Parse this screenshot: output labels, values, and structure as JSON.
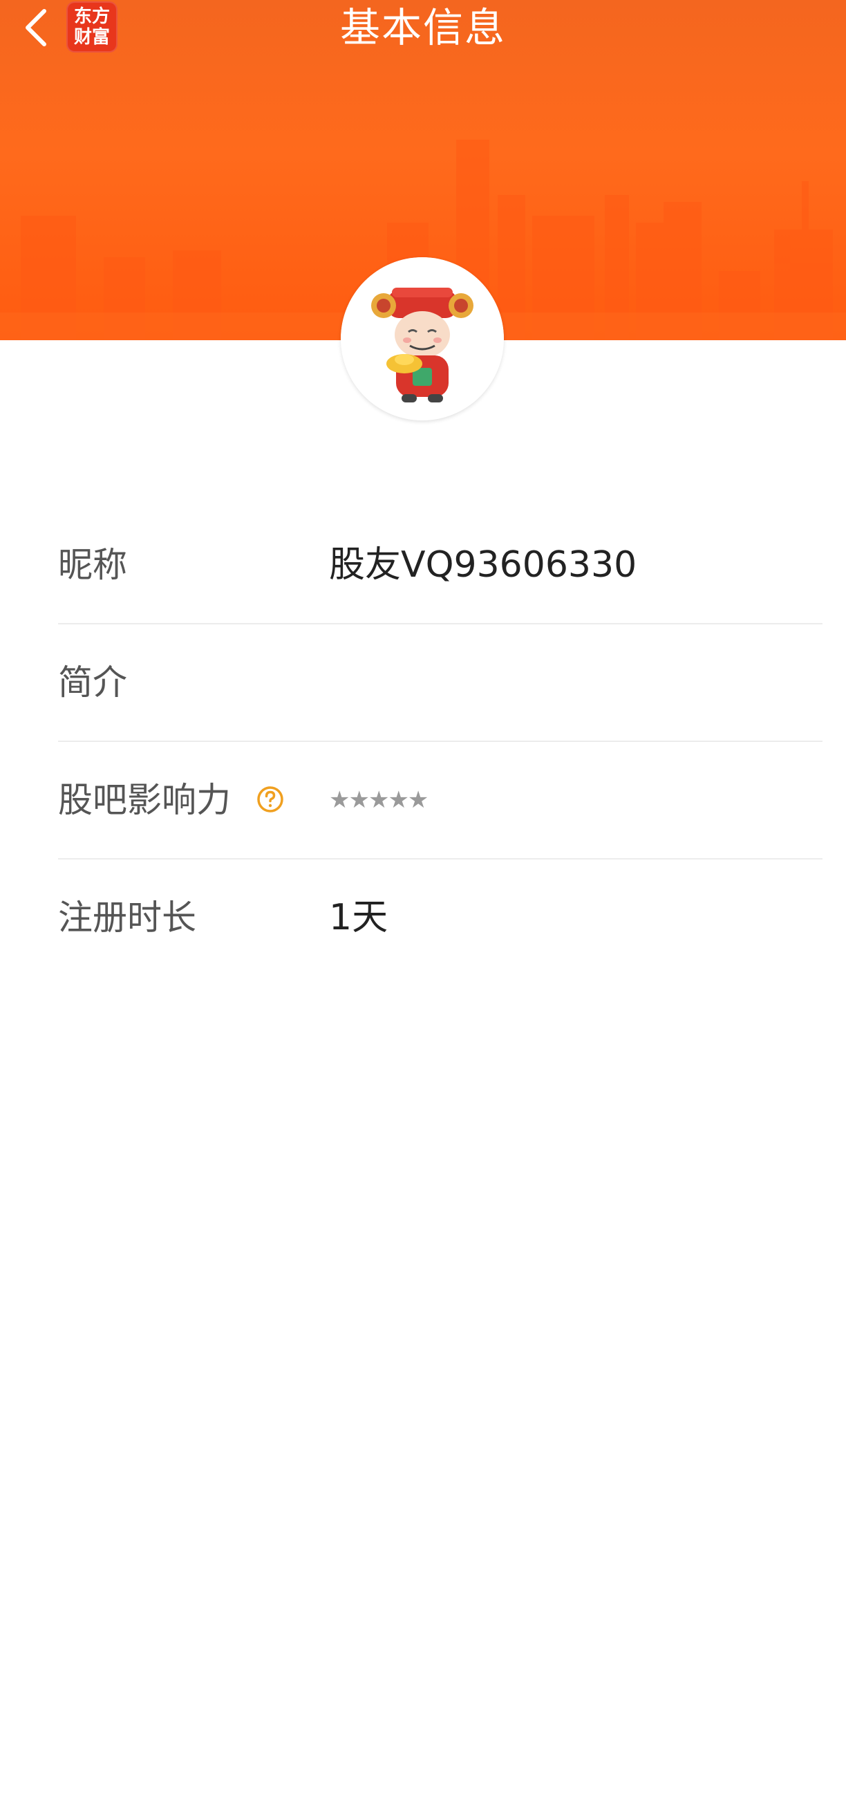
{
  "header": {
    "title": "基本信息",
    "brand_logo": {
      "line1": "东方",
      "line2": "财富"
    },
    "back_icon": "chevron-left-icon",
    "background_color": "#ff6a1c"
  },
  "avatar": {
    "icon": "god-of-wealth-avatar"
  },
  "info": {
    "nickname": {
      "label": "昵称",
      "value": "股友VQ93606330"
    },
    "intro": {
      "label": "简介",
      "value": ""
    },
    "influence": {
      "label": "股吧影响力",
      "stars": "★★★★★",
      "help_icon": "question-circle-icon",
      "help_color": "#f0a020"
    },
    "register": {
      "label": "注册时长",
      "value": "1天"
    }
  }
}
